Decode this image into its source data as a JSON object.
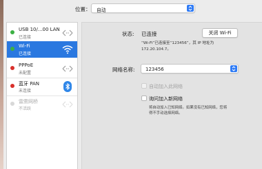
{
  "location": {
    "label": "位置：",
    "value": "自动"
  },
  "services": [
    {
      "name": "USB 10/...00 LAN",
      "status": "已连接",
      "dot": "#3cb043",
      "icon": "ethernet-arrows-icon"
    },
    {
      "name": "Wi-Fi",
      "status": "已连接",
      "dot": "#3cb043",
      "icon": "wifi-icon"
    },
    {
      "name": "PPPoE",
      "status": "未配置",
      "dot": "#d9302b",
      "icon": "ethernet-arrows-icon"
    },
    {
      "name": "蓝牙 PAN",
      "status": "未连接",
      "dot": "#d9302b",
      "icon": "bluetooth-icon"
    },
    {
      "name": "雷雳网桥",
      "status": "不活跃",
      "dot": "#d8d8d8",
      "icon": "ethernet-arrows-icon"
    }
  ],
  "detail": {
    "status_label": "状态:",
    "status_value": "已连接",
    "turn_off_button": "关闭 Wi-Fi",
    "status_description_line1": "“Wi-Fi”已连接至“123456”，其 IP 地址为",
    "status_description_line2": "172.20.104.7。",
    "network_name_label": "网络名称:",
    "network_name_value": "123456",
    "auto_join_label": "自动加入此网络",
    "ask_join_label": "询问加入新网络",
    "ask_join_note_line1": "将自动加入已知网络。如果没有已知网络，您将",
    "ask_join_note_line2": "得不手动选择网络。"
  },
  "colors": {
    "selection": "#2a78e0",
    "accent": "#2f7bf5"
  }
}
